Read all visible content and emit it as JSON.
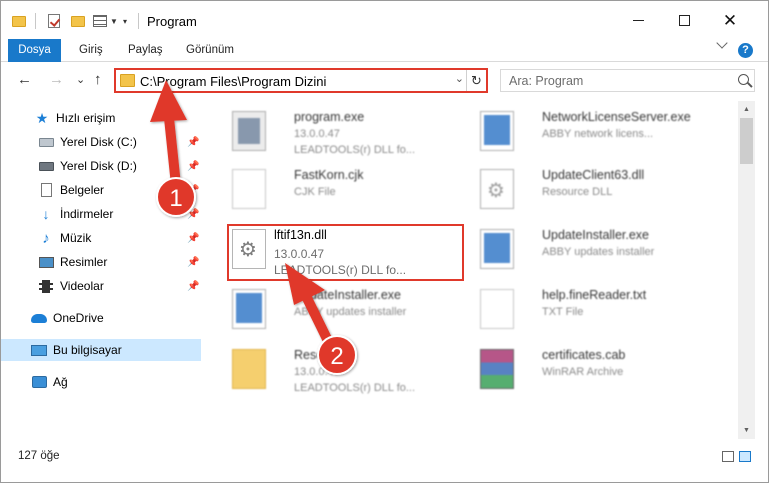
{
  "window": {
    "title": "Program",
    "controls": {
      "minimize": "minimize",
      "maximize": "maximize",
      "close": "✕"
    }
  },
  "ribbon": {
    "tabs": [
      "Dosya",
      "Giriş",
      "Paylaş",
      "Görünüm"
    ],
    "help_label": "?"
  },
  "navigation": {
    "back": "←",
    "forward": "→",
    "recent": "⌄",
    "up": "↑",
    "address": "C:\\Program Files\\Program Dizini",
    "refresh": "↻",
    "search_placeholder": "Ara: Program"
  },
  "sidebar": {
    "items": [
      {
        "label": "Hızlı erişim",
        "icon": "star-icon",
        "pinned": false
      },
      {
        "label": "Yerel Disk (C:)",
        "icon": "drive-icon",
        "pinned": true
      },
      {
        "label": "Yerel Disk (D:)",
        "icon": "drive-icon",
        "pinned": true
      },
      {
        "label": "Belgeler",
        "icon": "documents-icon",
        "pinned": true
      },
      {
        "label": "İndirmeler",
        "icon": "downloads-icon",
        "pinned": true
      },
      {
        "label": "Müzik",
        "icon": "music-icon",
        "pinned": true
      },
      {
        "label": "Resimler",
        "icon": "pictures-icon",
        "pinned": true
      },
      {
        "label": "Videolar",
        "icon": "videos-icon",
        "pinned": true
      },
      {
        "label": "OneDrive",
        "icon": "onedrive-icon",
        "pinned": false
      },
      {
        "label": "Bu bilgisayar",
        "icon": "this-pc-icon",
        "pinned": false,
        "selected": true
      },
      {
        "label": "Ağ",
        "icon": "network-icon",
        "pinned": false
      }
    ],
    "pin_glyph": "📌"
  },
  "files": {
    "left_column": [
      {
        "name": "program.exe",
        "meta1": "13.0.0.47",
        "meta2": "LEADTOOLS(r) DLL fo...",
        "icon": "exe-icon"
      },
      {
        "name": "FastKorn.cjk",
        "meta1": "CJK File",
        "meta2": "",
        "icon": "blank-file-icon"
      },
      {
        "name": "lftif13n.dll",
        "meta1": "13.0.0.47",
        "meta2": "LEADTOOLS(r) DLL fo...",
        "icon": "dll-gear-icon",
        "highlighted": true
      },
      {
        "name": "UpdateInstaller.exe",
        "meta1": "ABBY updates installer",
        "meta2": "",
        "icon": "window-app-icon"
      },
      {
        "name": "Resources",
        "meta1": "13.0.0.47",
        "meta2": "LEADTOOLS(r) DLL fo...",
        "icon": "folder-icon"
      }
    ],
    "right_column": [
      {
        "name": "NetworkLicenseServer.exe",
        "meta1": "ABBY network licens...",
        "meta2": "",
        "icon": "window-app-icon"
      },
      {
        "name": "UpdateClient63.dll",
        "meta1": "Resource DLL",
        "meta2": "",
        "icon": "dll-gear-icon"
      },
      {
        "name": "UpdateInstaller.exe",
        "meta1": "ABBY updates installer",
        "meta2": "",
        "icon": "window-app-icon"
      },
      {
        "name": "help.fineReader.txt",
        "meta1": "TXT File",
        "meta2": "",
        "icon": "blank-file-icon"
      },
      {
        "name": "certificates.cab",
        "meta1": "WinRAR Archive",
        "meta2": "",
        "icon": "winrar-icon"
      }
    ]
  },
  "annotations": {
    "step1": "1",
    "step2": "2",
    "accent_color": "#e0392b"
  },
  "status": {
    "item_count": "127 öğe"
  },
  "scrollbar": {
    "up": "▲",
    "down": "▼"
  }
}
